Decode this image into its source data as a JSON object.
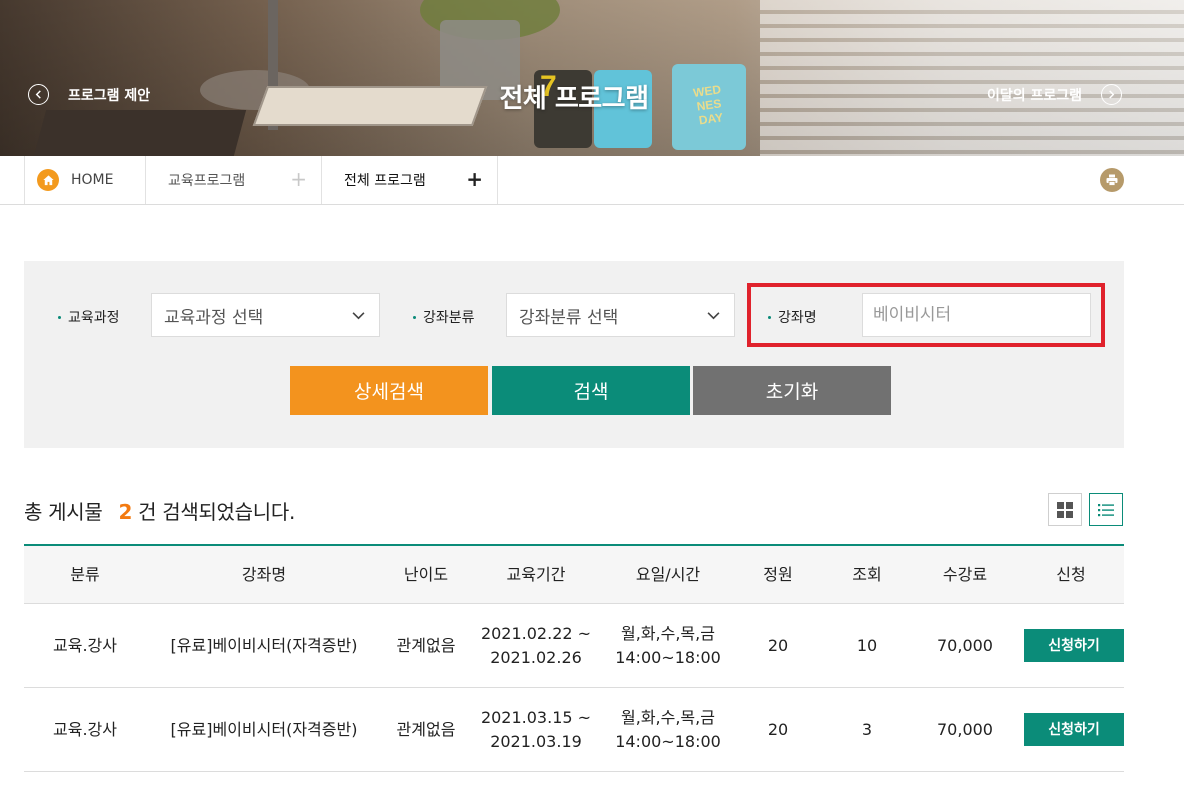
{
  "hero": {
    "title": "전체 프로그램",
    "prev_label": "프로그램 제안",
    "next_label": "이달의 프로그램",
    "calendar_number": "7",
    "calendar_word": "WED NES DAY"
  },
  "breadcrumb": {
    "home": "HOME",
    "level1": "교육프로그램",
    "level2": "전체 프로그램",
    "plus1": "+",
    "plus2": "+"
  },
  "filters": {
    "course_label": "교육과정",
    "course_value": "교육과정 선택",
    "category_label": "강좌분류",
    "category_value": "강좌분류 선택",
    "name_label": "강좌명",
    "name_placeholder": "베이비시터"
  },
  "buttons": {
    "detail": "상세검색",
    "search": "검색",
    "reset": "초기화"
  },
  "results": {
    "prefix": "총 게시물",
    "count": "2",
    "suffix": "건 검색되었습니다."
  },
  "table": {
    "headers": [
      "분류",
      "강좌명",
      "난이도",
      "교육기간",
      "요일/시간",
      "정원",
      "조회",
      "수강료",
      "신청"
    ],
    "rows": [
      {
        "category": "교육.강사",
        "name": "[유료]베이비시터(자격증반)",
        "level": "관계없음",
        "period_start": "2021.02.22 ~",
        "period_end": "2021.02.26",
        "days": "월,화,수,목,금",
        "time": "14:00~18:00",
        "capacity": "20",
        "views": "10",
        "fee": "70,000",
        "apply": "신청하기"
      },
      {
        "category": "교육.강사",
        "name": "[유료]베이비시터(자격증반)",
        "level": "관계없음",
        "period_start": "2021.03.15 ~",
        "period_end": "2021.03.19",
        "days": "월,화,수,목,금",
        "time": "14:00~18:00",
        "capacity": "20",
        "views": "3",
        "fee": "70,000",
        "apply": "신청하기"
      }
    ]
  },
  "colors": {
    "accent_green": "#0b8c79",
    "accent_orange": "#f3931e",
    "highlight_red": "#e0222c"
  }
}
